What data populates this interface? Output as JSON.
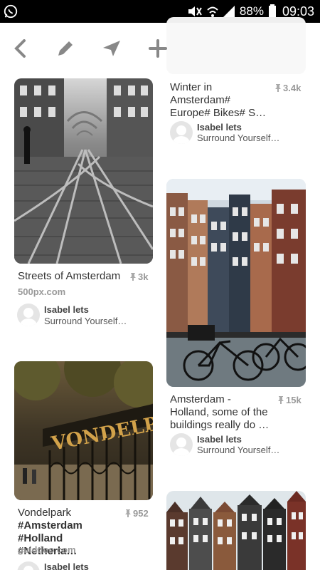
{
  "status": {
    "battery": "88%",
    "time": "09:03"
  },
  "icons": {
    "whatsapp": "whatsapp-icon",
    "mute": "mute-icon",
    "wifi": "wifi-icon",
    "signal": "signal-icon",
    "battery": "battery-icon",
    "back": "back-icon",
    "edit": "edit-icon",
    "send": "send-icon",
    "add": "add-icon"
  },
  "pins": [
    {
      "title": "Streets of Amsterdam",
      "count": "3k",
      "source": "500px.com",
      "user": "Isabel lets",
      "board": "Surround Yourself…"
    },
    {
      "title_lines": [
        "Winter in",
        "Amsterdam#",
        "Europe# Bikes# S…"
      ],
      "count": "3.4k",
      "user": "Isabel lets",
      "board": "Surround Yourself…"
    },
    {
      "title_lines": [
        "Amsterdam -",
        "Holland, some of the",
        "buildings really do …"
      ],
      "count": "15k",
      "user": "Isabel lets",
      "board": "Surround Yourself…"
    },
    {
      "title_lines": [
        "Vondelpark",
        "#Amsterdam",
        "#Holland #Netherla…"
      ],
      "count": "952",
      "source": "guiddoo.com",
      "user": "Isabel lets",
      "sign_text": "VONDELPARK"
    }
  ]
}
